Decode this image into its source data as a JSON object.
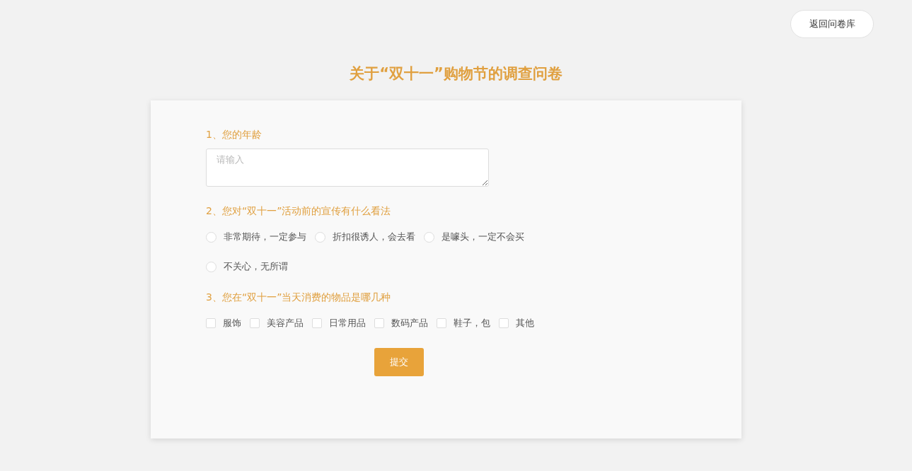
{
  "back_button": "返回问卷库",
  "title": "关于“双十一”购物节的调查问卷",
  "questions": [
    {
      "kind": "text",
      "label": "1、您的年龄",
      "placeholder": "请输入"
    },
    {
      "kind": "radio",
      "label": "2、您对“双十一”活动前的宣传有什么看法",
      "options": [
        {
          "label": "非常期待，一定参与",
          "selected": false
        },
        {
          "label": "折扣很诱人，会去看",
          "selected": false
        },
        {
          "label": "是噱头，一定不会买",
          "selected": false
        },
        {
          "label": "不关心，无所谓",
          "selected": false
        }
      ]
    },
    {
      "kind": "checkbox",
      "label": "3、您在“双十一”当天消费的物品是哪几种",
      "options": [
        {
          "label": "服饰",
          "checked": false
        },
        {
          "label": "美容产品",
          "checked": false
        },
        {
          "label": "日常用品",
          "checked": false
        },
        {
          "label": "数码产品",
          "checked": false
        },
        {
          "label": "鞋子，包",
          "checked": false
        },
        {
          "label": "其他",
          "checked": false
        }
      ]
    }
  ],
  "submit": "提交"
}
